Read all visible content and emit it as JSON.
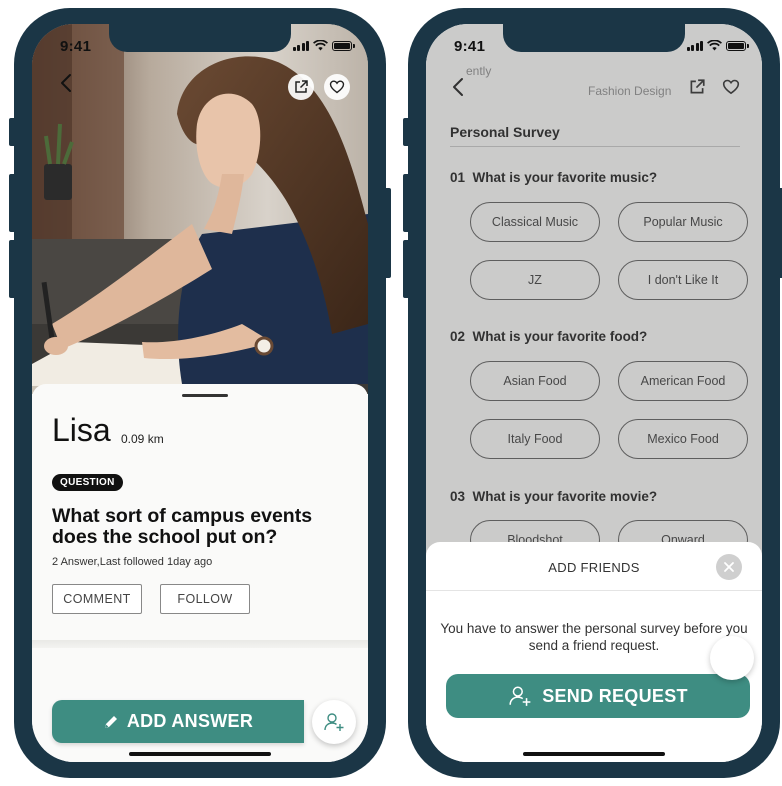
{
  "status_bar": {
    "time": "9:41"
  },
  "profile": {
    "name": "Lisa",
    "distance": "0.09 km",
    "tag": "QUESTION",
    "question": "What sort of campus events does the school put on?",
    "meta": "2 Answer,Last followed 1day ago",
    "comment_label": "COMMENT",
    "follow_label": "FOLLOW",
    "add_answer_label": "ADD ANSWER"
  },
  "survey": {
    "ghost_left": "ently",
    "ghost_center": "Fashion Design",
    "title": "Personal Survey",
    "questions": [
      {
        "number": "01",
        "text": "What is your favorite music?",
        "options": [
          "Classical Music",
          "Popular Music",
          "JZ",
          "I don't Like It"
        ]
      },
      {
        "number": "02",
        "text": "What is your favorite food?",
        "options": [
          "Asian Food",
          "American Food",
          "Italy Food",
          "Mexico  Food"
        ]
      },
      {
        "number": "03",
        "text": "What is your favorite movie?",
        "options": [
          "Bloodshot",
          "Onward"
        ]
      }
    ]
  },
  "sheet": {
    "title": "ADD FRIENDS",
    "message": "You have to answer the personal survey before you send a friend request.",
    "send_label": "SEND REQUEST"
  },
  "colors": {
    "phone_frame": "#1b3646",
    "accent": "#3e8d82"
  },
  "icons": [
    "back-arrow-icon",
    "share-icon",
    "heart-icon",
    "pencil-icon",
    "add-user-icon",
    "close-icon"
  ]
}
